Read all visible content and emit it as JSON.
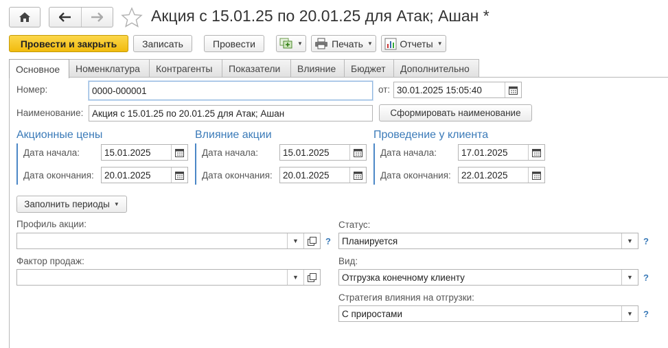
{
  "nav": {
    "home_icon": "home-icon",
    "back_icon": "arrow-left-icon",
    "forward_icon": "arrow-right-icon",
    "favorite_icon": "star-icon"
  },
  "title": "Акция с 15.01.25 по 20.01.25 для Атак; Ашан *",
  "toolbar": {
    "post_close": "Провести и закрыть",
    "save": "Записать",
    "post": "Провести",
    "print": "Печать",
    "reports": "Отчеты"
  },
  "tabs": [
    "Основное",
    "Номенклатура",
    "Контрагенты",
    "Показатели",
    "Влияние",
    "Бюджет",
    "Дополнительно"
  ],
  "form": {
    "number_label": "Номер:",
    "number_value": "0000-000001",
    "date_label": "от:",
    "date_value": "30.01.2025 15:05:40",
    "name_label": "Наименование:",
    "name_value": "Акция с 15.01.25 по 20.01.25 для Атак; Ашан",
    "generate_name": "Сформировать наименование"
  },
  "groups": [
    {
      "title": "Акционные цены",
      "start_label": "Дата начала:",
      "start_value": "15.01.2025",
      "end_label": "Дата окончания:",
      "end_value": "20.01.2025"
    },
    {
      "title": "Влияние акции",
      "start_label": "Дата начала:",
      "start_value": "15.01.2025",
      "end_label": "Дата окончания:",
      "end_value": "20.01.2025"
    },
    {
      "title": "Проведение у клиента",
      "start_label": "Дата начала:",
      "start_value": "17.01.2025",
      "end_label": "Дата окончания:",
      "end_value": "22.01.2025"
    }
  ],
  "fill_periods": "Заполнить периоды",
  "left_fields": {
    "profile_label": "Профиль акции:",
    "profile_value": "",
    "factor_label": "Фактор продаж:",
    "factor_value": ""
  },
  "right_fields": {
    "status_label": "Статус:",
    "status_value": "Планируется",
    "kind_label": "Вид:",
    "kind_value": "Отгрузка конечному клиенту",
    "strategy_label": "Стратегия влияния на отгрузки:",
    "strategy_value": "С приростами"
  },
  "help_mark": "?",
  "colors": {
    "accent": "#f1bb0e",
    "section": "#3a7ab8"
  }
}
